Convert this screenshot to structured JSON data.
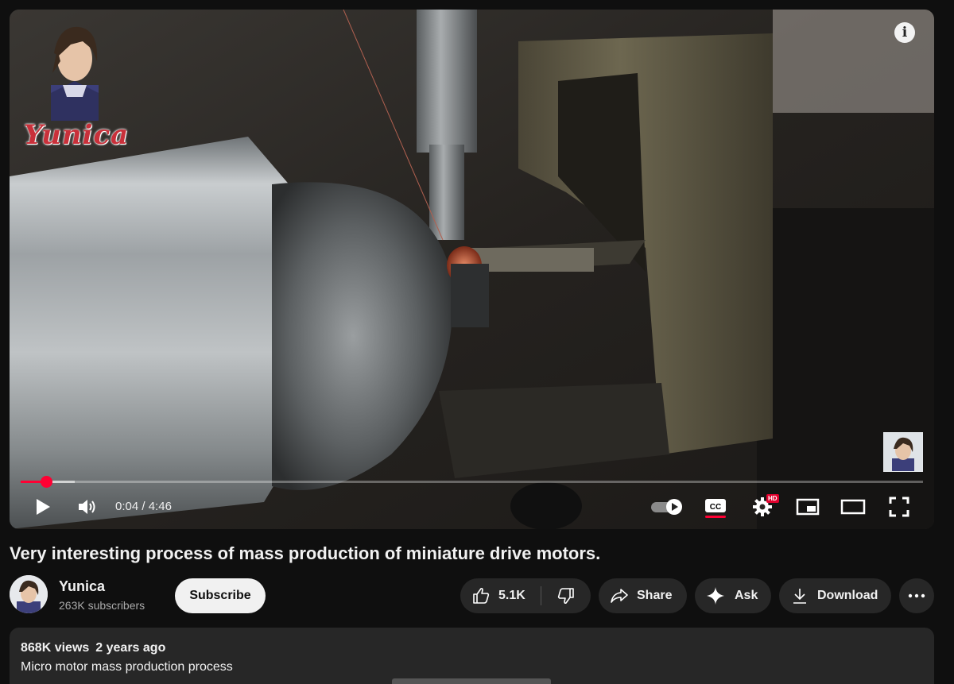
{
  "player": {
    "watermark_text": "Yunica",
    "current_time": "0:04",
    "duration": "4:46",
    "time_separator": " / ",
    "played_fraction": 0.028,
    "buffered_fraction": 0.06,
    "hd_badge": "HD",
    "icons": [
      "info-icon",
      "play-icon",
      "volume-icon",
      "autoplay-toggle-icon",
      "captions-icon",
      "settings-icon",
      "miniplayer-icon",
      "theater-icon",
      "fullscreen-icon"
    ]
  },
  "video": {
    "title": "Very interesting process of mass production of miniature drive motors."
  },
  "channel": {
    "name": "Yunica",
    "subscribers": "263K subscribers",
    "subscribe_label": "Subscribe"
  },
  "actions": {
    "like_count": "5.1K",
    "share_label": "Share",
    "ask_label": "Ask",
    "download_label": "Download"
  },
  "description": {
    "views": "868K views",
    "age": "2 years ago",
    "text": "Micro motor mass production process"
  },
  "colors": {
    "accent_red": "#ff0033",
    "background": "#0f0f0f",
    "pill_bg": "#272727"
  }
}
